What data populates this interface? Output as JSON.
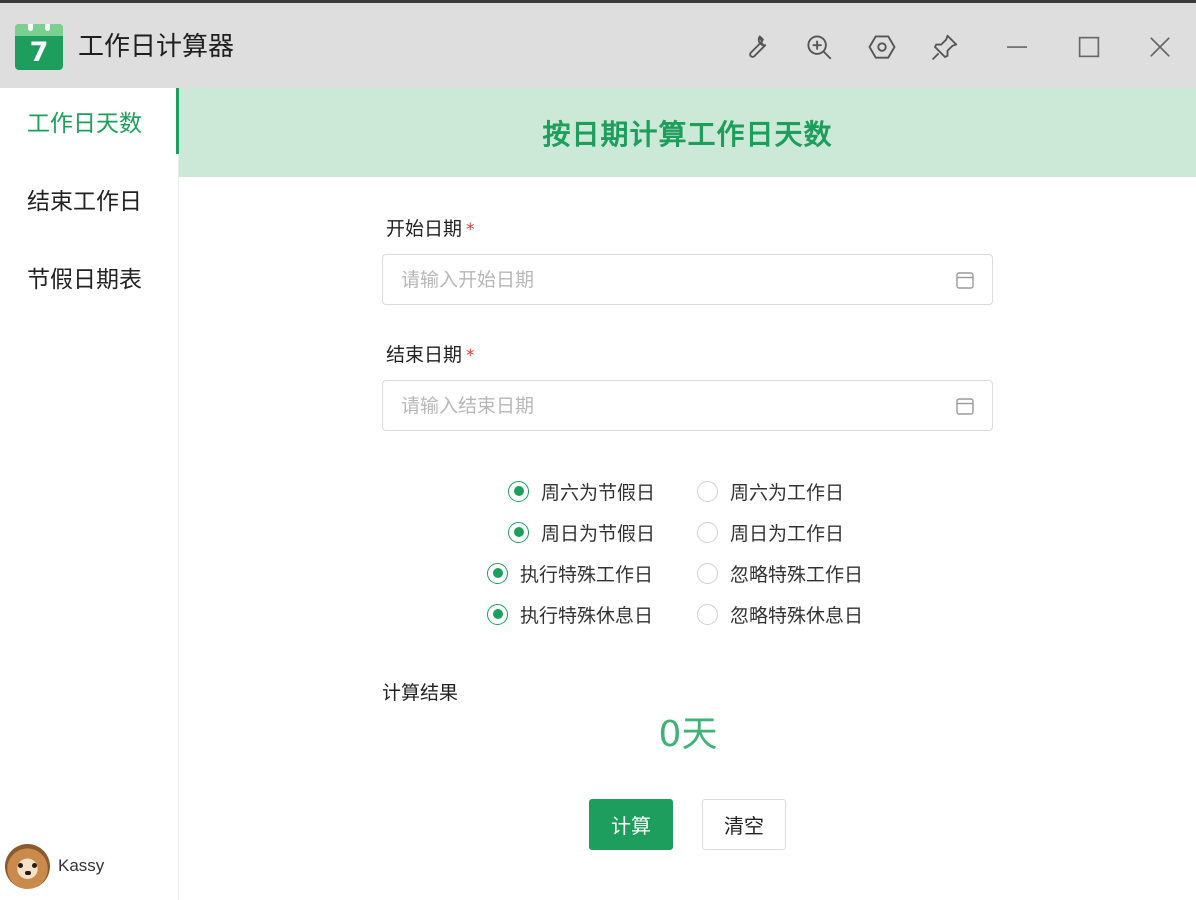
{
  "window": {
    "title": "工作日计算器",
    "logo_day": "7",
    "toolbar_icons": [
      "wrench-icon",
      "zoom-in-icon",
      "settings-hex-icon",
      "pin-icon"
    ],
    "controls": [
      "minimize-icon",
      "maximize-icon",
      "close-icon"
    ]
  },
  "sidebar": {
    "items": [
      {
        "label": "工作日天数",
        "active": true
      },
      {
        "label": "结束工作日",
        "active": false
      },
      {
        "label": "节假日期表",
        "active": false
      }
    ],
    "user": {
      "name": "Kassy"
    }
  },
  "main": {
    "title": "按日期计算工作日天数",
    "start_date": {
      "label": "开始日期",
      "required_mark": "*",
      "placeholder": "请输入开始日期",
      "value": ""
    },
    "end_date": {
      "label": "结束日期",
      "required_mark": "*",
      "placeholder": "请输入结束日期",
      "value": ""
    },
    "options": [
      {
        "selected": "周六为节假日",
        "alternative": "周六为工作日"
      },
      {
        "selected": "周日为节假日",
        "alternative": "周日为工作日"
      },
      {
        "selected": "执行特殊工作日",
        "alternative": "忽略特殊工作日"
      },
      {
        "selected": "执行特殊休息日",
        "alternative": "忽略特殊休息日"
      }
    ],
    "result": {
      "label": "计算结果",
      "value": "0天"
    },
    "buttons": {
      "calculate": "计算",
      "clear": "清空"
    }
  },
  "colors": {
    "accent": "#1e9e5c",
    "accent_light": "#cce9d8",
    "result_text": "#3fb277",
    "titlebar": "#dedede",
    "required": "#e53935"
  }
}
